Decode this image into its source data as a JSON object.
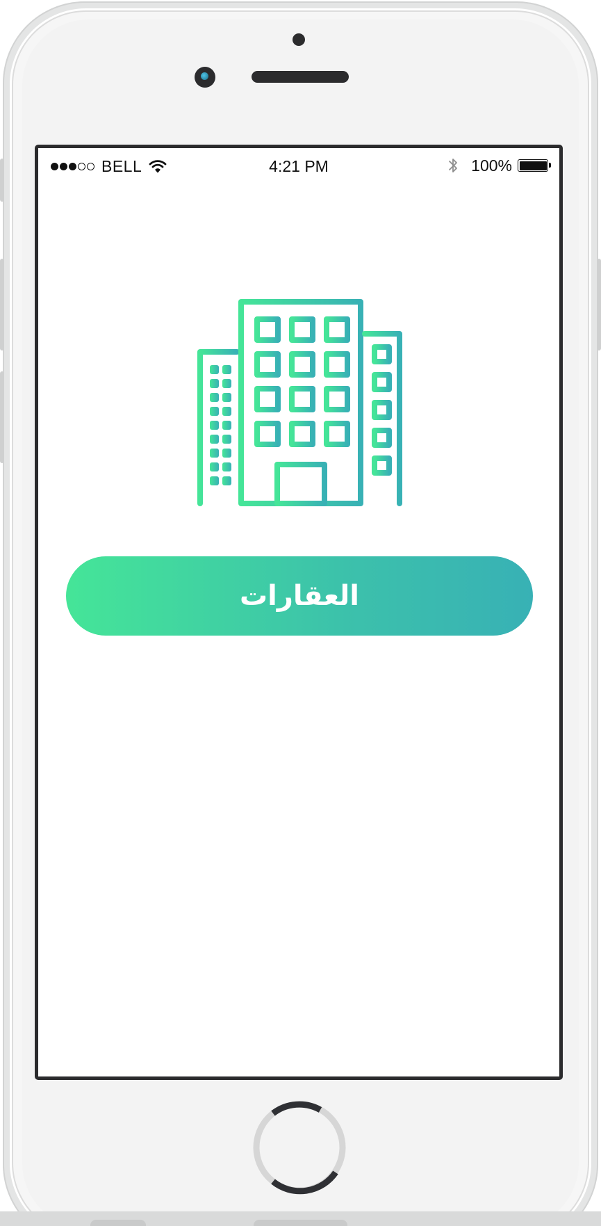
{
  "status_bar": {
    "signal_bars_filled": 3,
    "signal_bars_total": 5,
    "carrier": "BELL",
    "time": "4:21 PM",
    "battery_percent": "100%",
    "battery_level": 1.0,
    "icons": [
      "wifi-icon",
      "bluetooth-icon",
      "battery-icon"
    ]
  },
  "hero": {
    "icon": "buildings-icon",
    "gradient_start": "#45e598",
    "gradient_end": "#38b1b5"
  },
  "main": {
    "primary_button_label": "العقارات"
  }
}
